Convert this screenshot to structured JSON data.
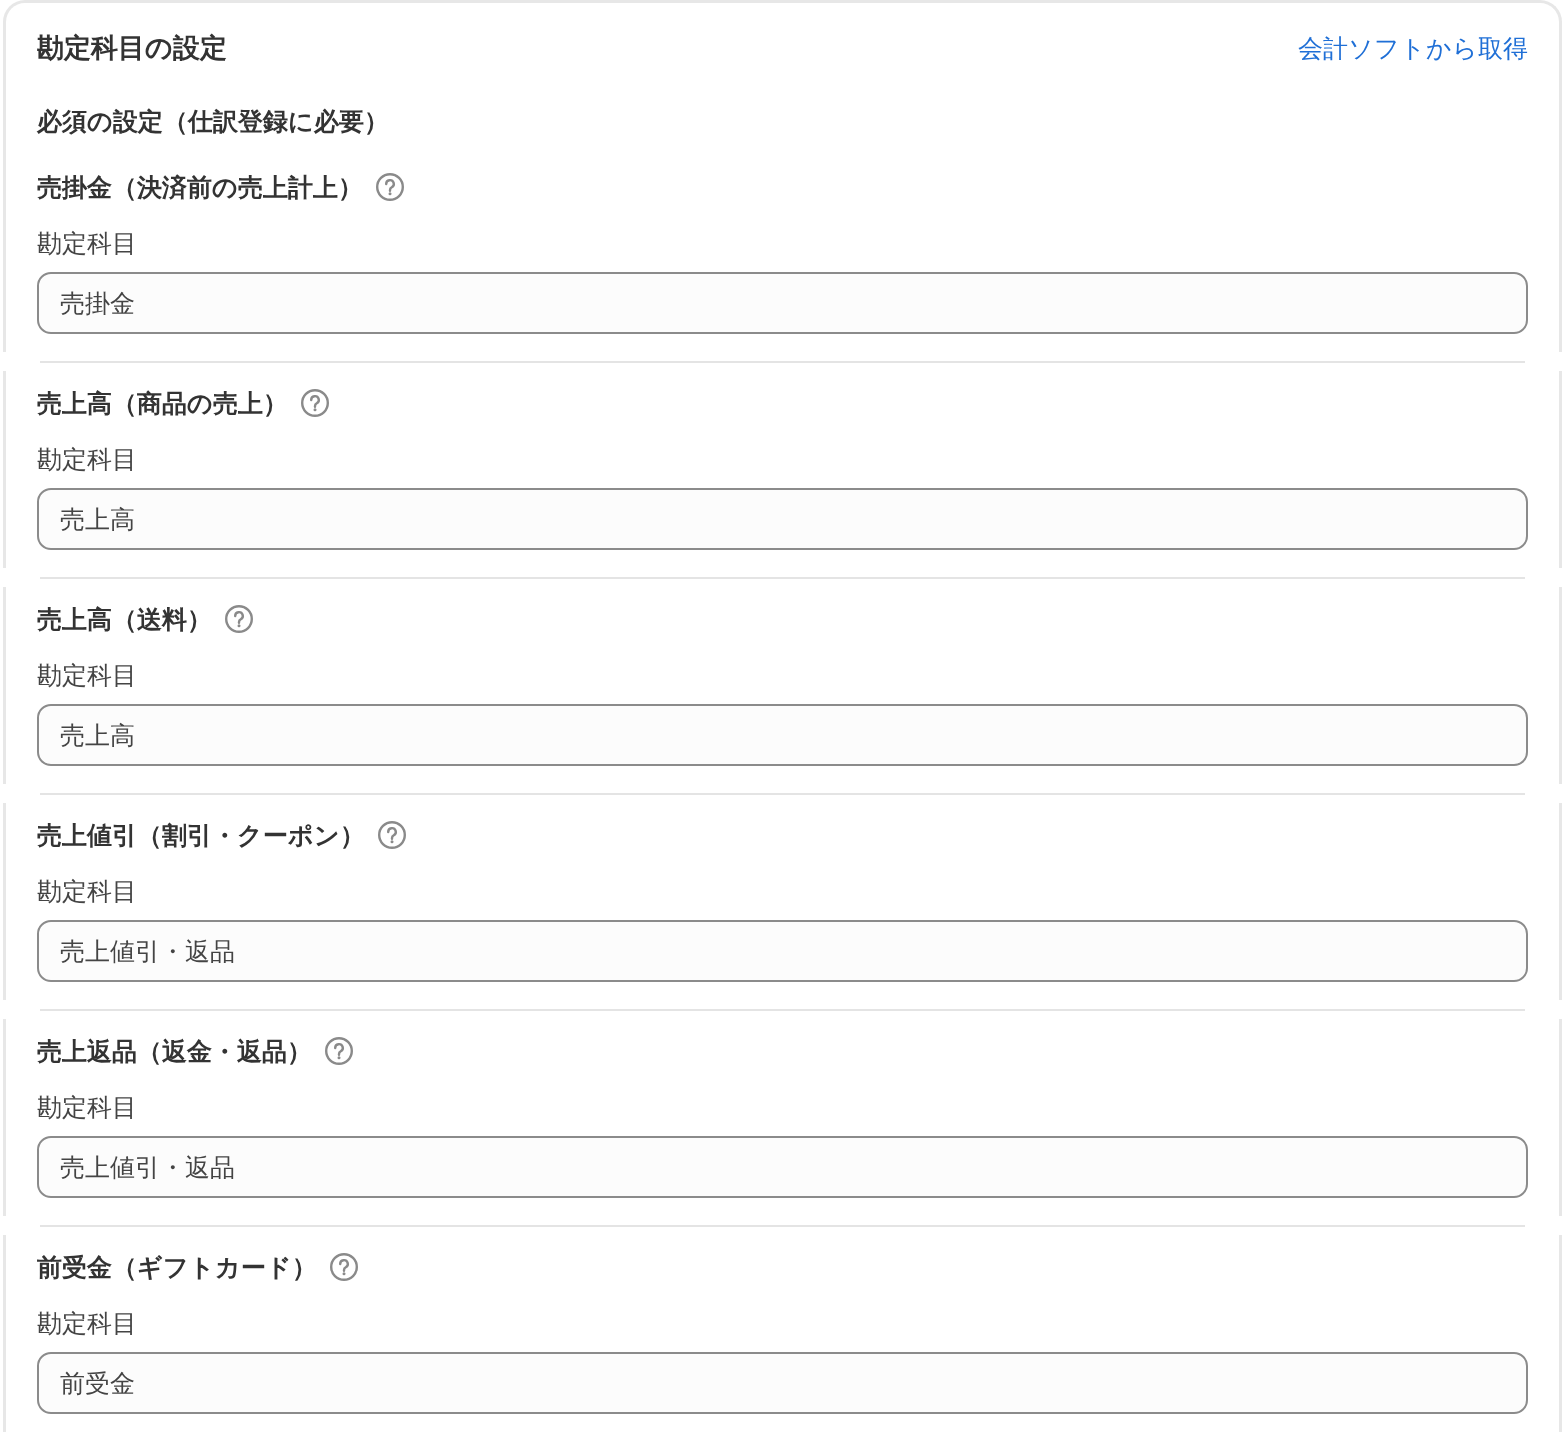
{
  "header": {
    "title": "勘定科目の設定",
    "link": "会計ソフトから取得"
  },
  "group_title": "必須の設定（仕訳登録に必要）",
  "accounts": [
    {
      "title": "売掛金（決済前の売上計上）",
      "field_label": "勘定科目",
      "value": "売掛金"
    },
    {
      "title": "売上高（商品の売上）",
      "field_label": "勘定科目",
      "value": "売上高"
    },
    {
      "title": "売上高（送料）",
      "field_label": "勘定科目",
      "value": "売上高"
    },
    {
      "title": "売上値引（割引・クーポン）",
      "field_label": "勘定科目",
      "value": "売上値引・返品"
    },
    {
      "title": "売上返品（返金・返品）",
      "field_label": "勘定科目",
      "value": "売上値引・返品"
    },
    {
      "title": "前受金（ギフトカード）",
      "field_label": "勘定科目",
      "value": "前受金"
    }
  ]
}
